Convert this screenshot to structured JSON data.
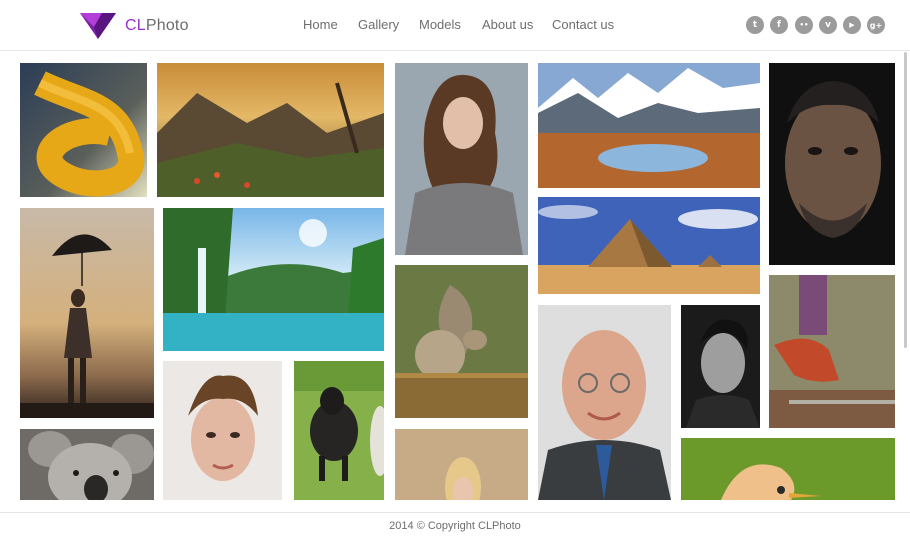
{
  "brand": {
    "prefix": "CL",
    "suffix": "Photo",
    "accent": "#9a2fc4"
  },
  "nav": [
    {
      "label": "Home"
    },
    {
      "label": "Gallery"
    },
    {
      "label": "Models"
    },
    {
      "label": "About us"
    },
    {
      "label": "Contact us"
    }
  ],
  "social": [
    {
      "icon": "twitter-icon",
      "glyph": "t"
    },
    {
      "icon": "facebook-icon",
      "glyph": "f"
    },
    {
      "icon": "flickr-icon",
      "glyph": "••"
    },
    {
      "icon": "vimeo-icon",
      "glyph": "v"
    },
    {
      "icon": "youtube-icon",
      "glyph": "▶"
    },
    {
      "icon": "google-plus-icon",
      "glyph": "g+"
    }
  ],
  "gallery": {
    "photos": [
      "rope-knot-photo",
      "mountain-meadow-sunset-photo",
      "woman-portrait-photo",
      "mountain-lake-reflection-photo",
      "man-closeup-portrait-photo",
      "girl-with-umbrella-photo",
      "waterfall-lagoon-photo",
      "pyramids-desert-photo",
      "squirrel-photo",
      "old-man-portrait-photo",
      "young-man-bw-portrait-photo",
      "running-shoe-photo",
      "koala-photo",
      "short-hair-woman-portrait-photo",
      "black-sheep-photo",
      "blonde-woman-field-photo",
      "bird-closeup-photo"
    ]
  },
  "footer": {
    "copyright": "2014 © Copyright CLPhoto"
  }
}
